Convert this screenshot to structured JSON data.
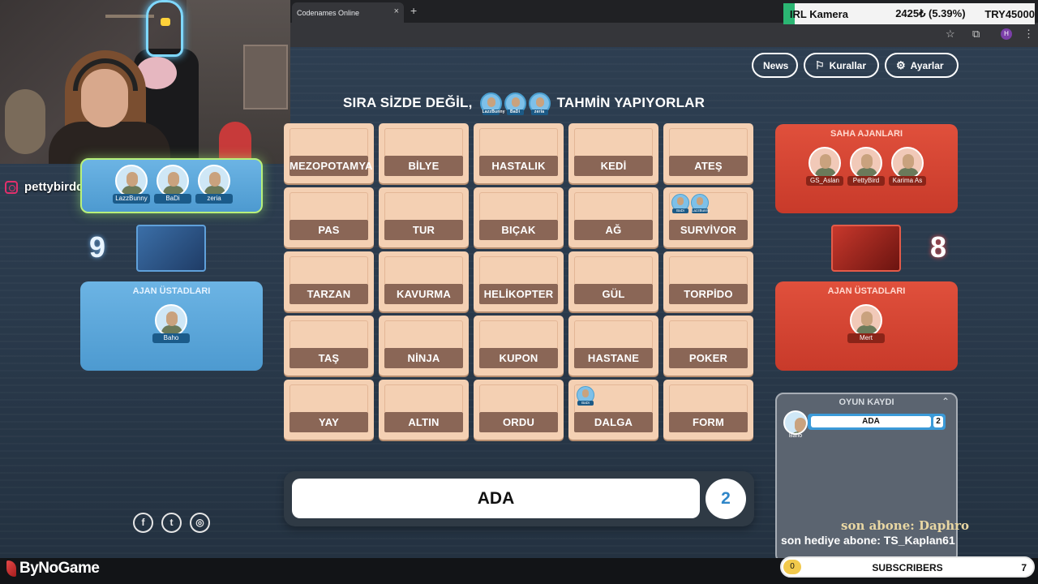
{
  "browser": {
    "tab_title": "Codenames Online",
    "close_glyph": "×",
    "new_tab_glyph": "+",
    "profile_initial": "H"
  },
  "ticker": {
    "label": "IRL Kamera",
    "value": "2425₺ (5.39%)",
    "goal": "TRY45000"
  },
  "streamer": {
    "instagram": "pettybirdd"
  },
  "header": {
    "news": "News",
    "rules": "Kurallar",
    "settings": "Ayarlar"
  },
  "status": {
    "prefix": "SIRA SİZDE DEĞİL,",
    "suffix": "TAHMİN YAPIYORLAR",
    "guessers": [
      "LazzBunny",
      "BaDi",
      "zeria"
    ]
  },
  "board": {
    "rows": [
      [
        "MEZOPOTAMYA",
        "BİLYE",
        "HASTALIK",
        "KEDİ",
        "ATEŞ"
      ],
      [
        "PAS",
        "TUR",
        "BIÇAK",
        "AĞ",
        "SURVİVOR"
      ],
      [
        "TARZAN",
        "KAVURMA",
        "HELİKOPTER",
        "GÜL",
        "TORPİDO"
      ],
      [
        "TAŞ",
        "NİNJA",
        "KUPON",
        "HASTANE",
        "POKER"
      ],
      [
        "YAY",
        "ALTIN",
        "ORDU",
        "DALGA",
        "FORM"
      ]
    ],
    "markers": {
      "survivor": [
        "BaDi",
        "LazzBunny"
      ],
      "dalga": [
        "BaDi"
      ]
    }
  },
  "blue_team": {
    "score": "9",
    "operatives": [
      "LazzBunny",
      "BaDi",
      "zeria"
    ],
    "spymasters_title": "AJAN ÜSTADLARI",
    "spymasters": [
      "Baho"
    ]
  },
  "red_team": {
    "score": "8",
    "operatives_title": "SAHA AJANLARI",
    "operatives": [
      "GS_Aslan",
      "PettyBird",
      "Karima As"
    ],
    "spymasters_title": "AJAN ÜSTADLARI",
    "spymasters": [
      "Mert"
    ]
  },
  "log": {
    "title": "OYUN KAYDI",
    "entry": {
      "player": "Baho",
      "word": "ADA",
      "count": "2"
    }
  },
  "clue": {
    "word": "ADA",
    "count": "2"
  },
  "social": {
    "facebook": "f",
    "twitter": "t",
    "instagram": "◎"
  },
  "overlay": {
    "last_sub": "son abone: Daphro",
    "last_gift": "son hediye abone: TS_Kaplan61",
    "brand": "ByNoGame",
    "subs_label": "SUBSCRIBERS",
    "subs_current": "0",
    "subs_goal": "7",
    "subs_progress": 0
  },
  "colors": {
    "card": "#f4d0b3",
    "card_label": "#8a6656",
    "blue_team": "#5ea8dc",
    "red_team": "#d9483a",
    "background": "#2b3a4a"
  }
}
